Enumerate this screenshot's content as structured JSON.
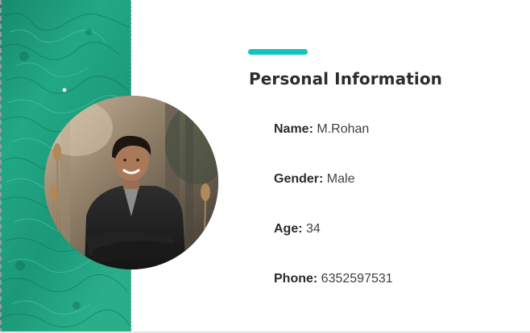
{
  "section": {
    "title": "Personal Information"
  },
  "fields": {
    "name": {
      "label": "Name:",
      "value": "M.Rohan"
    },
    "gender": {
      "label": "Gender:",
      "value": "Male"
    },
    "age": {
      "label": "Age:",
      "value": "34"
    },
    "phone": {
      "label": "Phone:",
      "value": "6352597531"
    }
  },
  "icons": {
    "avatar": "profile-photo",
    "texture": "green-water-texture"
  },
  "colors": {
    "accent": "#12c4c0",
    "panel": "#1e9a78",
    "title": "#2c2c2c",
    "text": "#333333"
  }
}
